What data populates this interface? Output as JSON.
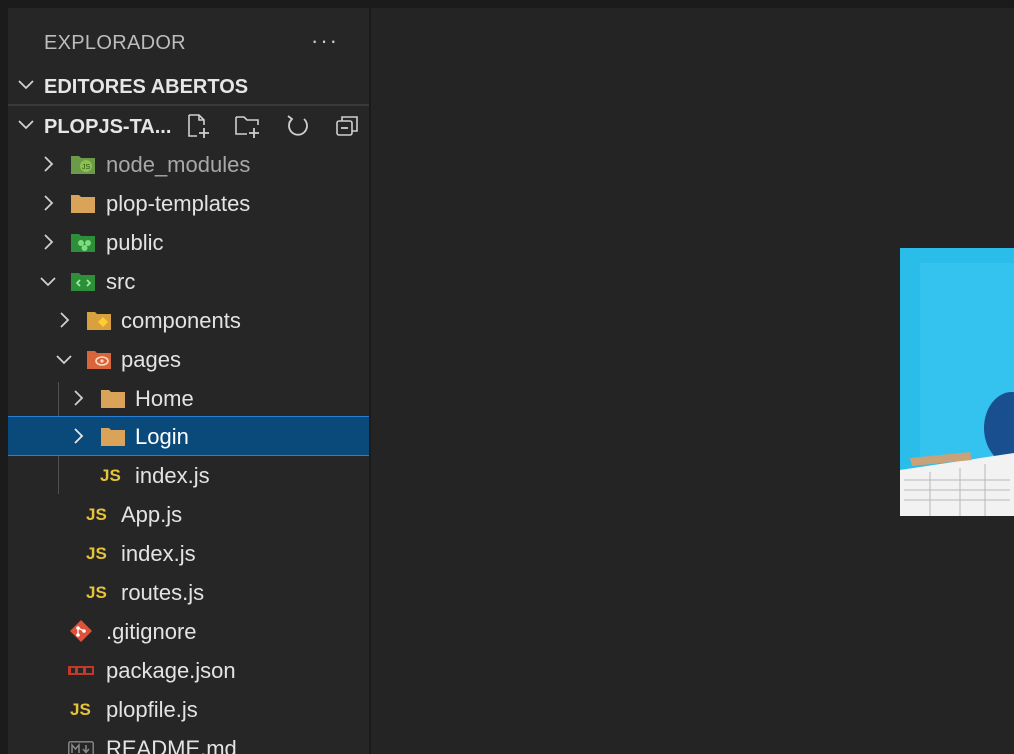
{
  "explorer": {
    "title": "EXPLORADOR",
    "more": "···",
    "open_editors": "EDITORES ABERTOS",
    "project": "PLOPJS-TA..."
  },
  "actions": [
    "new-file-icon",
    "new-folder-icon",
    "refresh-icon",
    "collapse-all-icon"
  ],
  "tree": [
    {
      "label": "node_modules",
      "icon": "node-modules-folder-icon"
    },
    {
      "label": "plop-templates",
      "icon": "folder-icon"
    },
    {
      "label": "public",
      "icon": "public-folder-icon"
    },
    {
      "label": "src",
      "icon": "src-folder-icon"
    },
    {
      "label": "components",
      "icon": "components-folder-icon"
    },
    {
      "label": "pages",
      "icon": "pages-folder-icon"
    },
    {
      "label": "Home",
      "icon": "folder-icon"
    },
    {
      "label": "Login",
      "icon": "folder-icon"
    },
    {
      "label": "index.js",
      "icon": "js-file-icon",
      "badge": "JS"
    },
    {
      "label": "App.js",
      "icon": "js-file-icon",
      "badge": "JS"
    },
    {
      "label": "index.js",
      "icon": "js-file-icon",
      "badge": "JS"
    },
    {
      "label": "routes.js",
      "icon": "js-file-icon",
      "badge": "JS"
    },
    {
      "label": ".gitignore",
      "icon": "git-icon"
    },
    {
      "label": "package.json",
      "icon": "npm-icon"
    },
    {
      "label": "plopfile.js",
      "icon": "js-file-icon",
      "badge": "JS"
    },
    {
      "label": "README.md",
      "icon": "markdown-icon"
    }
  ],
  "colors": {
    "sidebar": "#262626",
    "editor": "#242424",
    "selection": "#0a4a7a",
    "selection_border": "#2a7fd4",
    "folder": "#d9a45a",
    "js": "#e6c339"
  }
}
